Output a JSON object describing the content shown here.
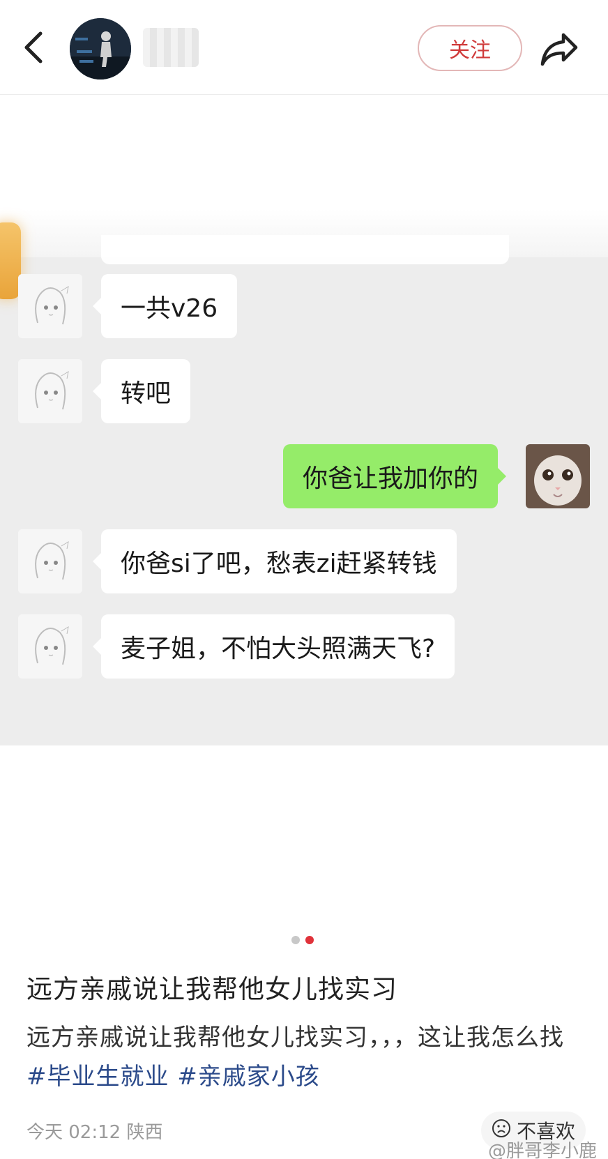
{
  "header": {
    "follow_label": "关注"
  },
  "chat": {
    "messages": [
      {
        "side": "left",
        "text": "一共v26"
      },
      {
        "side": "left",
        "text": "转吧"
      },
      {
        "side": "right",
        "text": "你爸让我加你的"
      },
      {
        "side": "left",
        "text": "你爸si了吧，愁表zi赶紧转钱"
      },
      {
        "side": "left",
        "text": "麦子姐，不怕大头照满天飞?"
      }
    ]
  },
  "pager": {
    "total": 2,
    "active": 2
  },
  "post": {
    "title": "远方亲戚说让我帮他女儿找实习",
    "body_text": "远方亲戚说让我帮他女儿找实习，，，这让我怎么找",
    "hashtags": [
      "#毕业生就业",
      "#亲戚家小孩"
    ],
    "time": "今天 02:12",
    "location": "陕西",
    "dislike_label": "不喜欢"
  },
  "watermark": "@胖哥李小鹿",
  "colors": {
    "accent_red": "#e0323a",
    "bubble_green": "#95ec69",
    "hashtag_blue": "#2b4a8a"
  }
}
